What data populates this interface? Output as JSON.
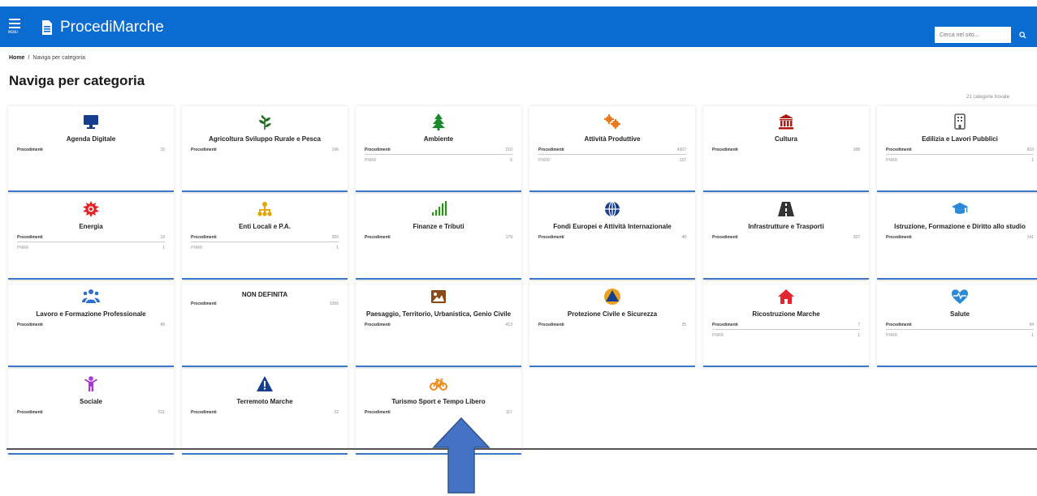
{
  "header": {
    "menu_label": "MENU",
    "app_title": "ProcediMarche",
    "search_placeholder": "Cerca nel sito...",
    "brand_color": "#0a6bd1"
  },
  "breadcrumb": {
    "home": "Home",
    "separator": "/",
    "current": "Naviga per categoria"
  },
  "page_title": "Naviga per categoria",
  "category_count": "21 categorie trovate",
  "cards": [
    {
      "title": "Agenda Digitale",
      "icon": "monitor-icon",
      "icon_color": "#173e8c",
      "rows": [
        {
          "label": "Procedimenti",
          "value": "15"
        }
      ]
    },
    {
      "title": "Agricoltura Sviluppo Rurale e Pesca",
      "icon": "plant-icon",
      "icon_color": "#1f6b1f",
      "rows": [
        {
          "label": "Procedimenti",
          "value": "196"
        }
      ]
    },
    {
      "title": "Ambiente",
      "icon": "tree-icon",
      "icon_color": "#1a8a2e",
      "rows": [
        {
          "label": "Procedimenti",
          "value": "210"
        },
        {
          "label": "PNRR",
          "value": "6"
        }
      ]
    },
    {
      "title": "Attività Produttive",
      "icon": "gears-icon",
      "icon_color": "#e87a1d",
      "rows": [
        {
          "label": "Procedimenti",
          "value": "4307"
        },
        {
          "label": "PNRR",
          "value": "137"
        }
      ]
    },
    {
      "title": "Cultura",
      "icon": "museum-icon",
      "icon_color": "#b0180f",
      "rows": [
        {
          "label": "Procedimenti",
          "value": "188"
        }
      ]
    },
    {
      "title": "Edilizia e Lavori Pubblici",
      "icon": "building-icon",
      "icon_color": "#555555",
      "rows": [
        {
          "label": "Procedimenti",
          "value": "603"
        },
        {
          "label": "PNRR",
          "value": "1"
        }
      ]
    },
    {
      "title": "Energia",
      "icon": "sun-icon",
      "icon_color": "#e3262e",
      "rows": [
        {
          "label": "Procedimenti",
          "value": "19"
        },
        {
          "label": "PNRR",
          "value": "1"
        }
      ]
    },
    {
      "title": "Enti Locali e P.A.",
      "icon": "org-chart-icon",
      "icon_color": "#e3a600",
      "rows": [
        {
          "label": "Procedimenti",
          "value": "350"
        },
        {
          "label": "PNRR",
          "value": "1"
        }
      ]
    },
    {
      "title": "Finanze e Tributi",
      "icon": "signal-bars-icon",
      "icon_color": "#2f8f1f",
      "rows": [
        {
          "label": "Procedimenti",
          "value": "179"
        }
      ]
    },
    {
      "title": "Fondi Europei e Attività Internazionale",
      "icon": "globe-icon",
      "icon_color": "#173e8c",
      "rows": [
        {
          "label": "Procedimenti",
          "value": "40"
        }
      ]
    },
    {
      "title": "Infrastrutture e Trasporti",
      "icon": "road-icon",
      "icon_color": "#333333",
      "rows": [
        {
          "label": "Procedimenti",
          "value": "207"
        }
      ]
    },
    {
      "title": "Istruzione, Formazione e Diritto allo studio",
      "icon": "graduation-cap-icon",
      "icon_color": "#2b8ad8",
      "rows": [
        {
          "label": "Procedimenti",
          "value": "141"
        }
      ]
    },
    {
      "title": "Lavoro e Formazione Professionale",
      "icon": "users-icon",
      "icon_color": "#2b6fd1",
      "rows": [
        {
          "label": "Procedimenti",
          "value": "89"
        }
      ]
    },
    {
      "title": "NON DEFINITA",
      "icon": "",
      "icon_color": "",
      "rows": [
        {
          "label": "Procedimenti",
          "value": "1056"
        }
      ]
    },
    {
      "title": "Paesaggio, Territorio, Urbanistica, Genio Civile",
      "icon": "image-icon",
      "icon_color": "#8a4a18",
      "rows": [
        {
          "label": "Procedimenti",
          "value": "413"
        }
      ]
    },
    {
      "title": "Protezione Civile e Sicurezza",
      "icon": "civil-protection-icon",
      "icon_color": "#e8a21d",
      "rows": [
        {
          "label": "Procedimenti",
          "value": "25"
        }
      ]
    },
    {
      "title": "Ricostruzione Marche",
      "icon": "house-icon",
      "icon_color": "#e3262e",
      "rows": [
        {
          "label": "Procedimenti",
          "value": "7"
        },
        {
          "label": "PNRR",
          "value": "1"
        }
      ]
    },
    {
      "title": "Salute",
      "icon": "heartbeat-icon",
      "icon_color": "#2b8ad8",
      "rows": [
        {
          "label": "Procedimenti",
          "value": "94"
        },
        {
          "label": "PNRR",
          "value": "1"
        }
      ]
    },
    {
      "title": "Sociale",
      "icon": "child-icon",
      "icon_color": "#a83ad1",
      "rows": [
        {
          "label": "Procedimenti",
          "value": "511"
        }
      ]
    },
    {
      "title": "Terremoto Marche",
      "icon": "warning-icon",
      "icon_color": "#173e8c",
      "rows": [
        {
          "label": "Procedimenti",
          "value": "22"
        }
      ]
    },
    {
      "title": "Turismo Sport e Tempo Libero",
      "icon": "bicycle-icon",
      "icon_color": "#f08a1d",
      "rows": [
        {
          "label": "Procedimenti",
          "value": "117"
        }
      ]
    }
  ],
  "annotation_arrow_color": "#4472c4"
}
